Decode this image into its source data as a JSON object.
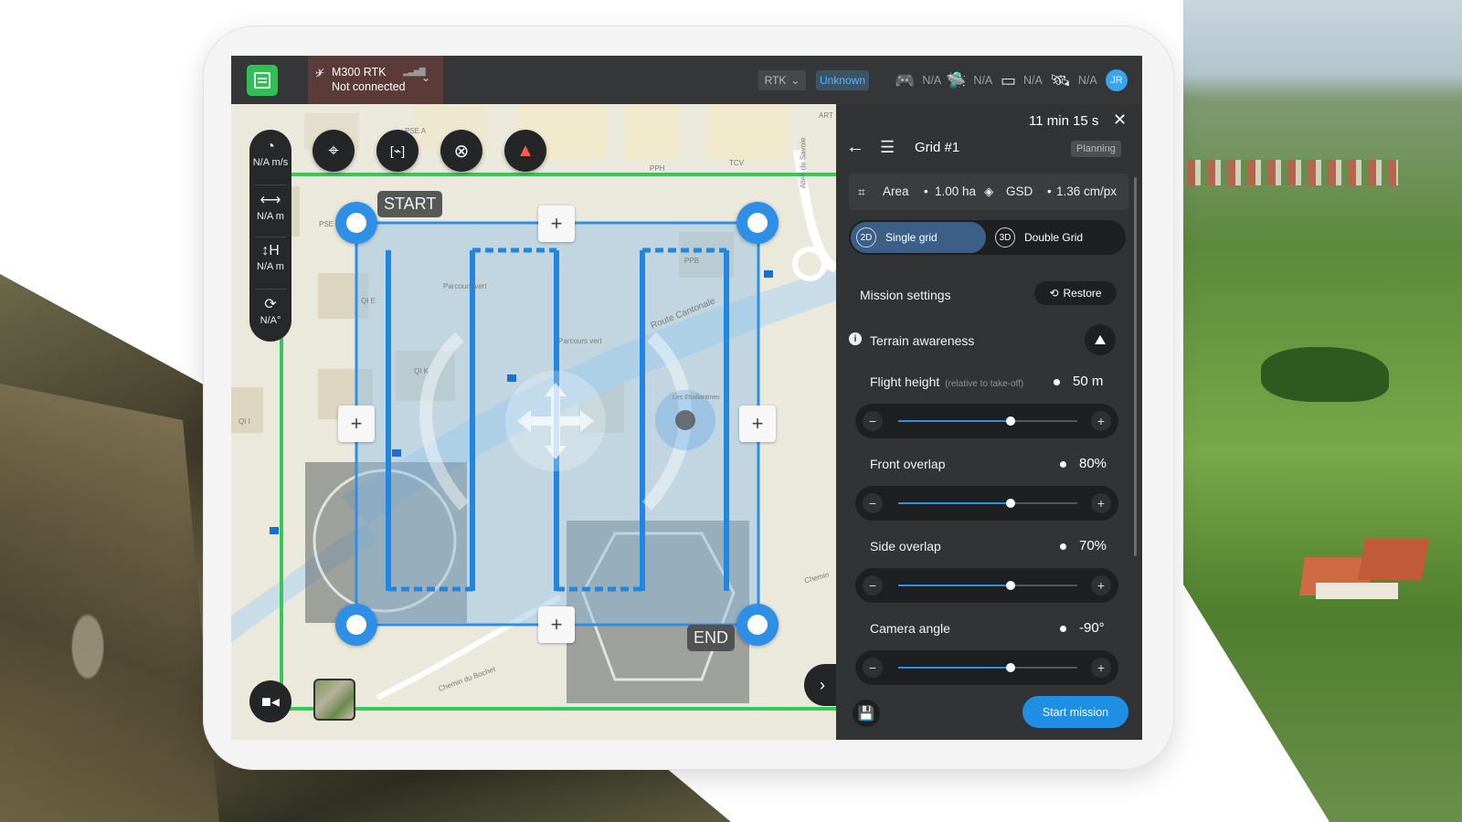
{
  "app": {
    "drone_name": "M300 RTK",
    "connection_status": "Not connected",
    "rtk_label": "RTK",
    "rtk_status": "Unknown",
    "status_items": [
      {
        "icon": "remote-controller-icon",
        "value": "N/A"
      },
      {
        "icon": "drone-battery-icon",
        "value": "N/A"
      },
      {
        "icon": "sd-card-icon",
        "value": "N/A"
      },
      {
        "icon": "satellite-icon",
        "value": "N/A"
      }
    ],
    "user_initials": "JR"
  },
  "telemetry": {
    "speed": "N/A m/s",
    "distance": "N/A m",
    "height": "N/A m",
    "heading": "N/A°"
  },
  "map": {
    "start_label": "START",
    "end_label": "END",
    "street_labels": [
      "Route Cantonale",
      "Parcours vert",
      "Parcours vert",
      "Chemin du Bochet",
      "Allée de Savoie",
      "Les Etudiantines",
      "PSE A",
      "PPH",
      "TCV",
      "PSE",
      "PPB",
      "QI E",
      "QI K",
      "QI I",
      "ART",
      "Chemin"
    ]
  },
  "panel": {
    "duration": "11 min 15 s",
    "title": "Grid #1",
    "status_badge": "Planning",
    "area_label": "Area",
    "area_value": "1.00 ha",
    "gsd_label": "GSD",
    "gsd_value": "1.36 cm/px",
    "grid_options": [
      {
        "badge": "2D",
        "label": "Single grid",
        "selected": true
      },
      {
        "badge": "3D",
        "label": "Double Grid",
        "selected": false
      }
    ],
    "mission_settings_label": "Mission settings",
    "restore_label": "Restore",
    "terrain_awareness_label": "Terrain awareness",
    "params": [
      {
        "label": "Flight height",
        "hint": "(relative to take-off)",
        "value": "50 m",
        "level": 0.63
      },
      {
        "label": "Front overlap",
        "hint": "",
        "value": "80%",
        "level": 0.63
      },
      {
        "label": "Side overlap",
        "hint": "",
        "value": "70%",
        "level": 0.63
      },
      {
        "label": "Camera angle",
        "hint": "",
        "value": "-90°",
        "level": 0.63
      }
    ],
    "start_mission_label": "Start mission"
  },
  "colors": {
    "accent": "#2e8fe6",
    "boundary": "#34c759",
    "brand": "#2fbf55",
    "disconnected": "#5a3b38"
  }
}
